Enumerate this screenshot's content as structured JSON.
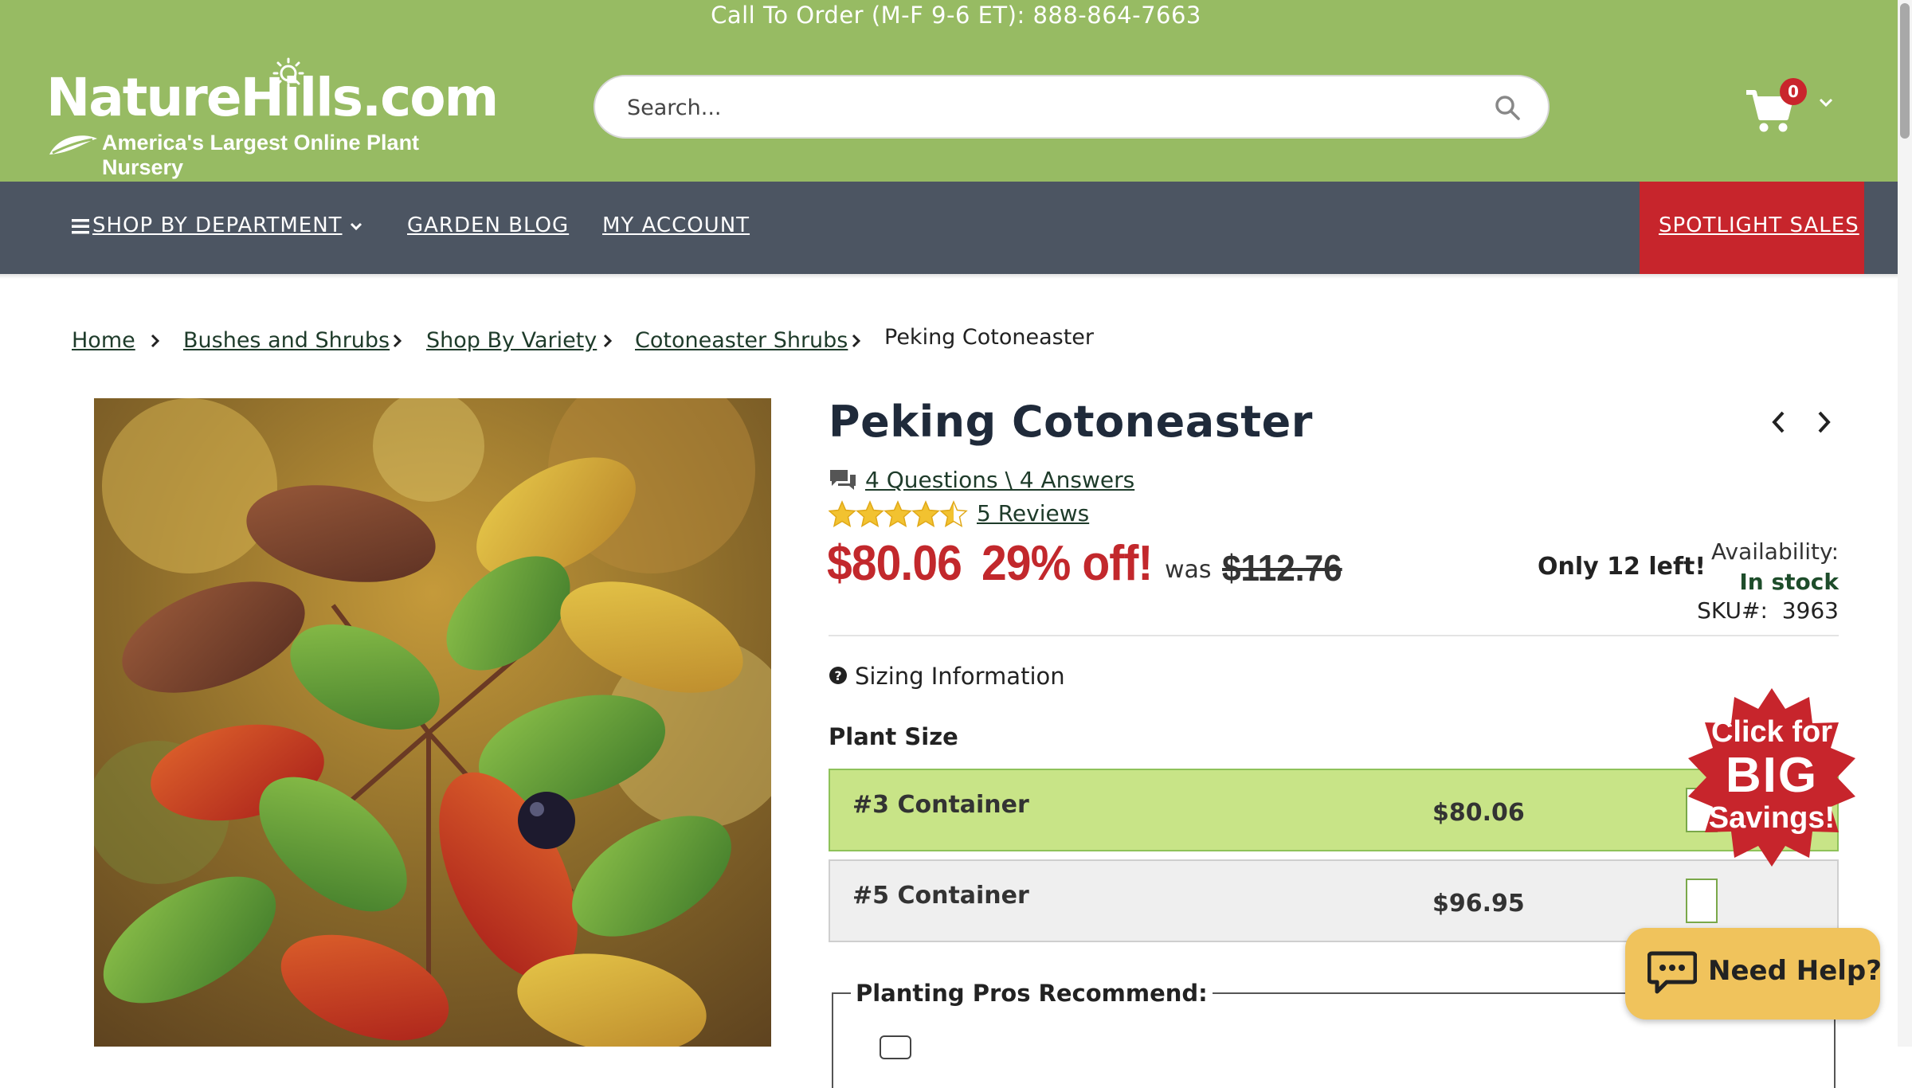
{
  "header": {
    "call_to_order": "Call To Order (M-F 9-6 ET): 888-864-7663",
    "logo_text": "NatureHills.com",
    "logo_tagline": "America's Largest Online Plant Nursery",
    "search_placeholder": "Search...",
    "cart_count": "0"
  },
  "nav": {
    "shop_by_department": " SHOP BY DEPARTMENT",
    "garden_blog": "GARDEN BLOG",
    "my_account": "MY ACCOUNT",
    "spotlight_sales": "SPOTLIGHT SALES"
  },
  "breadcrumb": {
    "items": [
      "Home",
      "Bushes and Shrubs",
      "Shop By Variety",
      "Cotoneaster Shrubs"
    ],
    "current": "Peking Cotoneaster"
  },
  "product": {
    "title": "Peking Cotoneaster",
    "questions_answers": "4 Questions \\ 4 Answers",
    "rating": 4.5,
    "reviews": "5 Reviews",
    "price": "$80.06",
    "discount": "29% off!",
    "was_label": "was",
    "old_price": "$112.76",
    "stock_left": "Only 12 left!",
    "availability_label": "Availability:",
    "availability_value": "In stock",
    "sku_label": "SKU#:",
    "sku_value": "3963",
    "sizing_info": "Sizing Information",
    "plant_size_label": "Plant Size",
    "options": [
      {
        "name": "#3 Container",
        "price": "$80.06",
        "selected": true
      },
      {
        "name": "#5 Container",
        "price": "$96.95",
        "selected": false
      }
    ],
    "planting_pros": "Planting Pros Recommend:"
  },
  "promo": {
    "line1": "Click for",
    "line2": "BIG",
    "line3": "Savings!"
  },
  "help": {
    "label": "Need Help?"
  },
  "colors": {
    "header_green": "#97bb63",
    "nav_gray": "#4c5562",
    "sale_red": "#c7252c",
    "price_red": "#c2282c",
    "selected_option": "#c8e487",
    "help_yellow": "#f0c35c"
  }
}
